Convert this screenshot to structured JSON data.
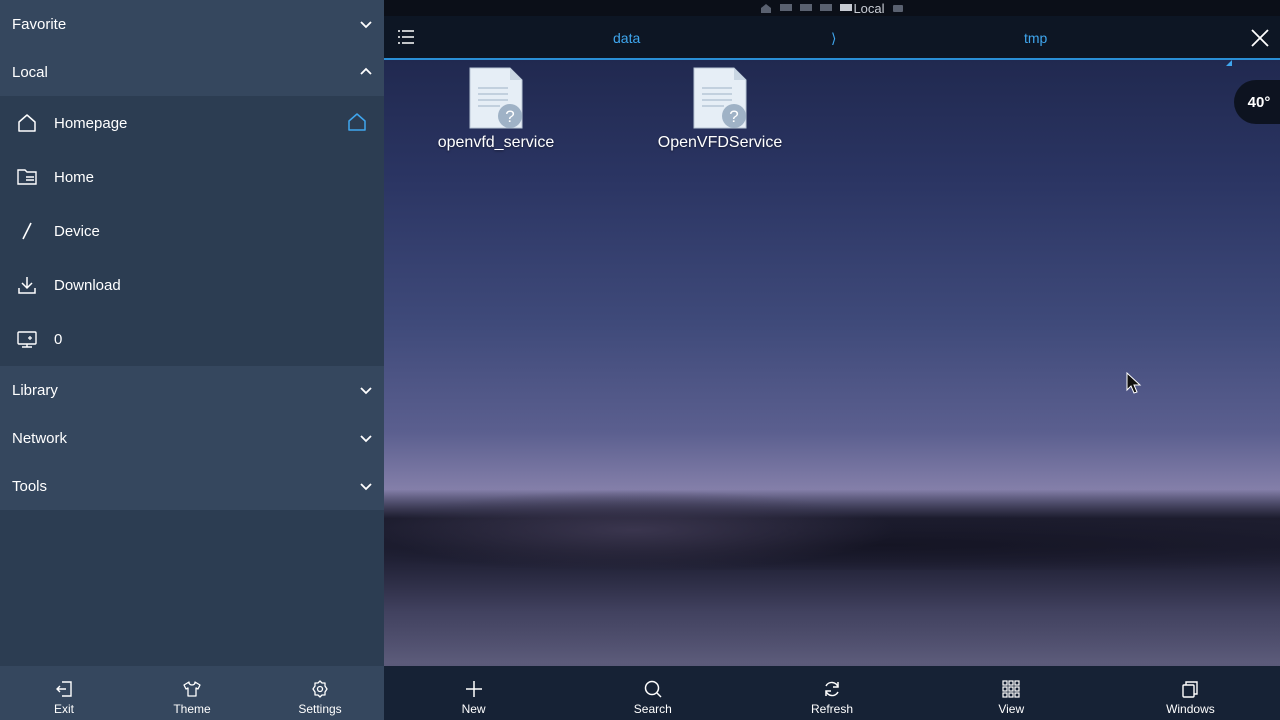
{
  "sidebar": {
    "sections": {
      "favorite": "Favorite",
      "local": "Local",
      "library": "Library",
      "network": "Network",
      "tools": "Tools"
    },
    "local_items": [
      {
        "label": "Homepage",
        "icon": "house-icon"
      },
      {
        "label": "Home",
        "icon": "folder-list-icon"
      },
      {
        "label": "Device",
        "icon": "slash-icon"
      },
      {
        "label": "Download",
        "icon": "download-icon"
      },
      {
        "label": "0",
        "icon": "monitor-icon"
      }
    ],
    "bottom": {
      "exit": "Exit",
      "theme": "Theme",
      "settings": "Settings"
    }
  },
  "statusbar": {
    "label": "Local"
  },
  "pathbar": {
    "crumbs": [
      "data",
      "tmp"
    ],
    "separator": "⟩"
  },
  "files": [
    {
      "name": "openvfd_service",
      "icon": "unknown-file-icon"
    },
    {
      "name": "OpenVFDService",
      "icon": "unknown-file-icon"
    }
  ],
  "temperature": "40°",
  "toolbar": {
    "new": "New",
    "search": "Search",
    "refresh": "Refresh",
    "view": "View",
    "windows": "Windows"
  },
  "colors": {
    "accent": "#3fa6ee",
    "sidebar_bg": "#2c3d52",
    "section_bg": "#35475e",
    "toolbar_bg": "#162235"
  }
}
